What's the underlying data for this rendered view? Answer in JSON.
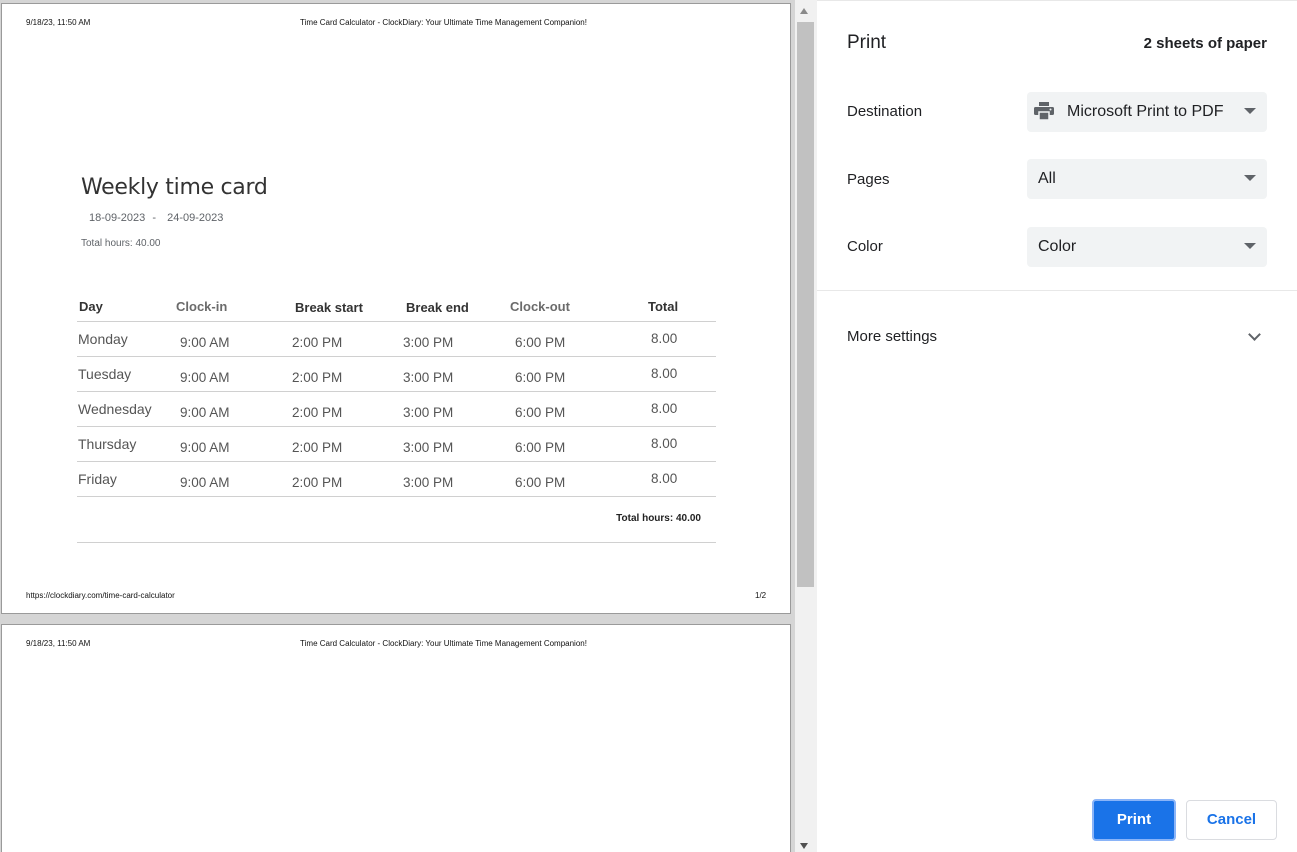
{
  "preview": {
    "header_date": "9/18/23, 11:50 AM",
    "header_title": "Time Card Calculator - ClockDiary: Your Ultimate Time Management Companion!",
    "footer_url": "https://clockdiary.com/time-card-calculator",
    "footer_page": "1/2",
    "doc_title": "Weekly time card",
    "date_start": "18-09-2023",
    "date_sep": "-",
    "date_end": "24-09-2023",
    "total_hours_top": "Total hours: 40.00",
    "columns": [
      "Day",
      "Clock-in",
      "Break start",
      "Break end",
      "Clock-out",
      "Total"
    ],
    "rows": [
      {
        "day": "Monday",
        "clock_in": "9:00 AM",
        "break_start": "2:00 PM",
        "break_end": "3:00 PM",
        "clock_out": "6:00 PM",
        "total": "8.00"
      },
      {
        "day": "Tuesday",
        "clock_in": "9:00 AM",
        "break_start": "2:00 PM",
        "break_end": "3:00 PM",
        "clock_out": "6:00 PM",
        "total": "8.00"
      },
      {
        "day": "Wednesday",
        "clock_in": "9:00 AM",
        "break_start": "2:00 PM",
        "break_end": "3:00 PM",
        "clock_out": "6:00 PM",
        "total": "8.00"
      },
      {
        "day": "Thursday",
        "clock_in": "9:00 AM",
        "break_start": "2:00 PM",
        "break_end": "3:00 PM",
        "clock_out": "6:00 PM",
        "total": "8.00"
      },
      {
        "day": "Friday",
        "clock_in": "9:00 AM",
        "break_start": "2:00 PM",
        "break_end": "3:00 PM",
        "clock_out": "6:00 PM",
        "total": "8.00"
      }
    ],
    "total_hours_bottom": "Total hours: 40.00",
    "page2_header_date": "9/18/23, 11:50 AM",
    "page2_header_title": "Time Card Calculator - ClockDiary: Your Ultimate Time Management Companion!"
  },
  "panel": {
    "title": "Print",
    "sheets": "2 sheets of paper",
    "destination_label": "Destination",
    "destination_value": "Microsoft Print to PDF",
    "destination_icon": "printer-icon",
    "pages_label": "Pages",
    "pages_value": "All",
    "color_label": "Color",
    "color_value": "Color",
    "more_settings": "More settings",
    "print_button": "Print",
    "cancel_button": "Cancel"
  },
  "colors": {
    "accent": "#1a73e8",
    "select_bg": "#f1f3f4",
    "preview_bg": "#d5d5d5"
  }
}
